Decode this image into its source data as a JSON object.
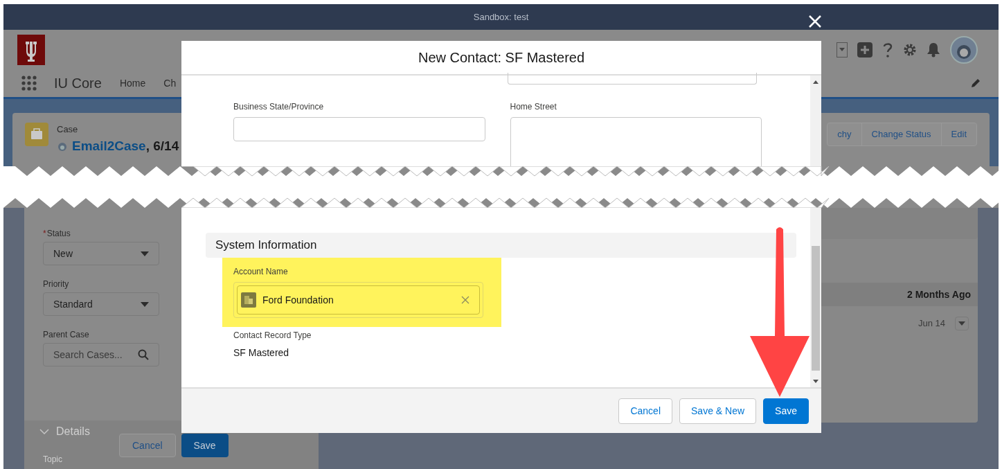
{
  "banner": {
    "text": "Sandbox: test"
  },
  "app": {
    "name": "IU Core",
    "nav_items": [
      "Home",
      "Ch"
    ]
  },
  "record": {
    "object": "Case",
    "title": "Email2Case",
    "title_suffix": ", 6/14",
    "actions": [
      "chy",
      "Change Status",
      "Edit"
    ]
  },
  "case_form": {
    "fields": [
      {
        "label": "Status",
        "required_mark": "*",
        "kind": "select",
        "value": "New"
      },
      {
        "label": "Priority",
        "kind": "select",
        "value": "Standard"
      },
      {
        "label": "Parent Case",
        "kind": "search",
        "placeholder": "Search Cases..."
      }
    ],
    "section": "Details",
    "next_label": "Topic",
    "buttons": [
      "Cancel",
      "Save"
    ]
  },
  "activity": {
    "group": "2 Months Ago",
    "date": "Jun 14"
  },
  "modal": {
    "title": "New Contact: SF Mastered",
    "fields": [
      {
        "label": "Business State/Province",
        "kind": "input"
      },
      {
        "label": "Home Street",
        "kind": "textarea"
      }
    ],
    "section": "System Information",
    "account": {
      "label": "Account Name",
      "value": "Ford Foundation",
      "highlighted": true
    },
    "record_type": {
      "label": "Contact Record Type",
      "value": "SF Mastered"
    },
    "buttons": [
      {
        "label": "Cancel",
        "kind": "neutral"
      },
      {
        "label": "Save & New",
        "kind": "neutral"
      },
      {
        "label": "Save",
        "kind": "brand"
      }
    ]
  }
}
